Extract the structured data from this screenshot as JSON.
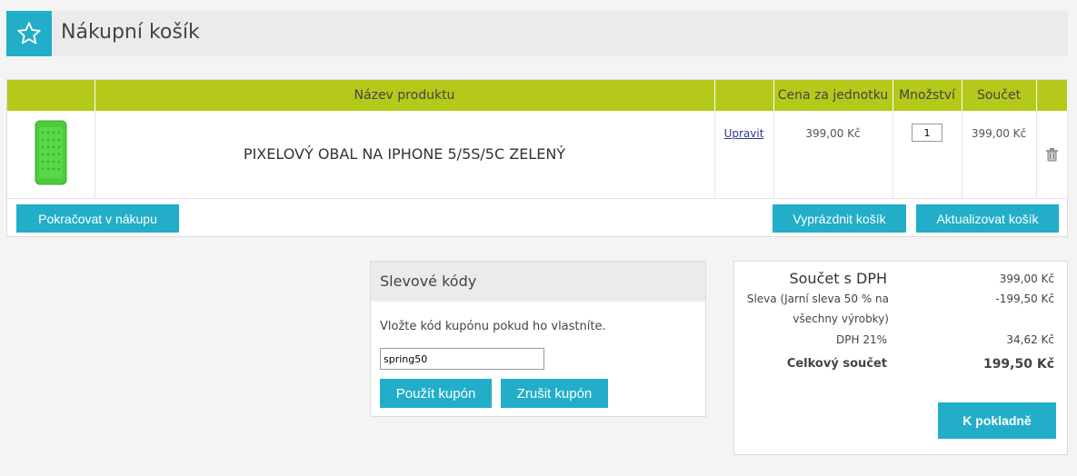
{
  "header": {
    "title": "Nákupní košík"
  },
  "table": {
    "columns": [
      "",
      "Název produktu",
      "",
      "Cena za jednotku",
      "Množství",
      "Součet",
      ""
    ],
    "items": [
      {
        "name": "PIXELOVÝ OBAL NA IPHONE 5/5S/5C ZELENÝ",
        "edit_label": "Upravit",
        "unit_price": "399,00 Kč",
        "quantity": "1",
        "total": "399,00 Kč"
      }
    ]
  },
  "actions": {
    "continue": "Pokračovat v nákupu",
    "empty": "Vyprázdnit košík",
    "update": "Aktualizovat košík"
  },
  "coupon": {
    "title": "Slevové kódy",
    "instruction": "Vložte kód kupónu pokud ho vlastníte.",
    "value": "spring50",
    "apply": "Použít kupón",
    "cancel": "Zrušit kupón"
  },
  "totals": {
    "subtotal_label": "Součet s DPH",
    "subtotal_value": "399,00 Kč",
    "discount_label": "Sleva (Jarní sleva 50 % na všechny výrobky)",
    "discount_value": "-199,50 Kč",
    "vat_label": "DPH 21%",
    "vat_value": "34,62 Kč",
    "grand_label": "Celkový součet",
    "grand_value": "199,50 Kč",
    "checkout": "K pokladně"
  },
  "colors": {
    "accent": "#22aec8",
    "table_header": "#b5c91b"
  }
}
